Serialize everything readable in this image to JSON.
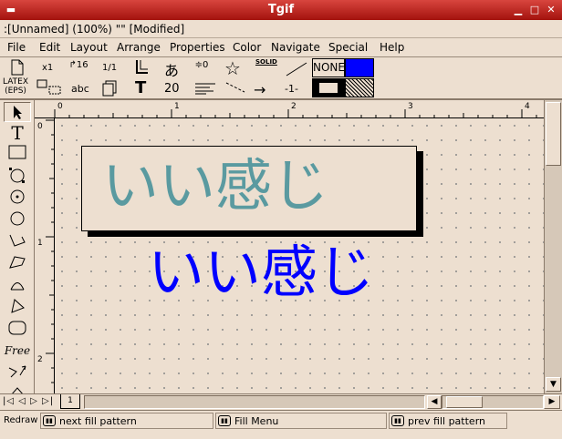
{
  "window": {
    "title": "Tgif"
  },
  "file_status": ":[Unnamed] (100%) \"\" [Modified]",
  "menu": [
    "File",
    "Edit",
    "Layout",
    "Arrange",
    "Properties",
    "Color",
    "Navigate",
    "Special",
    "Help"
  ],
  "toolbar": {
    "x1": "x1",
    "arrow16": "16",
    "ratio": "1/1",
    "jp_char": "あ",
    "spacing": "0",
    "solid": "SOLID",
    "none": "NONE",
    "latex_top": "LATEX",
    "latex_bottom": "(EPS)",
    "abc": "abc",
    "twenty": "20",
    "dash_one": "-1-"
  },
  "ruler": {
    "h_marks": [
      "0",
      "1",
      "2",
      "3",
      "4"
    ],
    "v_marks": [
      "0",
      "1",
      "2"
    ]
  },
  "canvas": {
    "boxed_text": "いい感じ",
    "blue_text": "いい感じ"
  },
  "tabs": {
    "page": "1"
  },
  "status": {
    "redraw": "Redraw",
    "left": "next fill pattern",
    "middle": "Fill Menu",
    "right": "prev fill pattern"
  },
  "colors": {
    "title_bar": "#b8201a",
    "bg": "#eddfd0",
    "accent_blue": "#0000ff",
    "teal_text": "#5a9aa0"
  }
}
